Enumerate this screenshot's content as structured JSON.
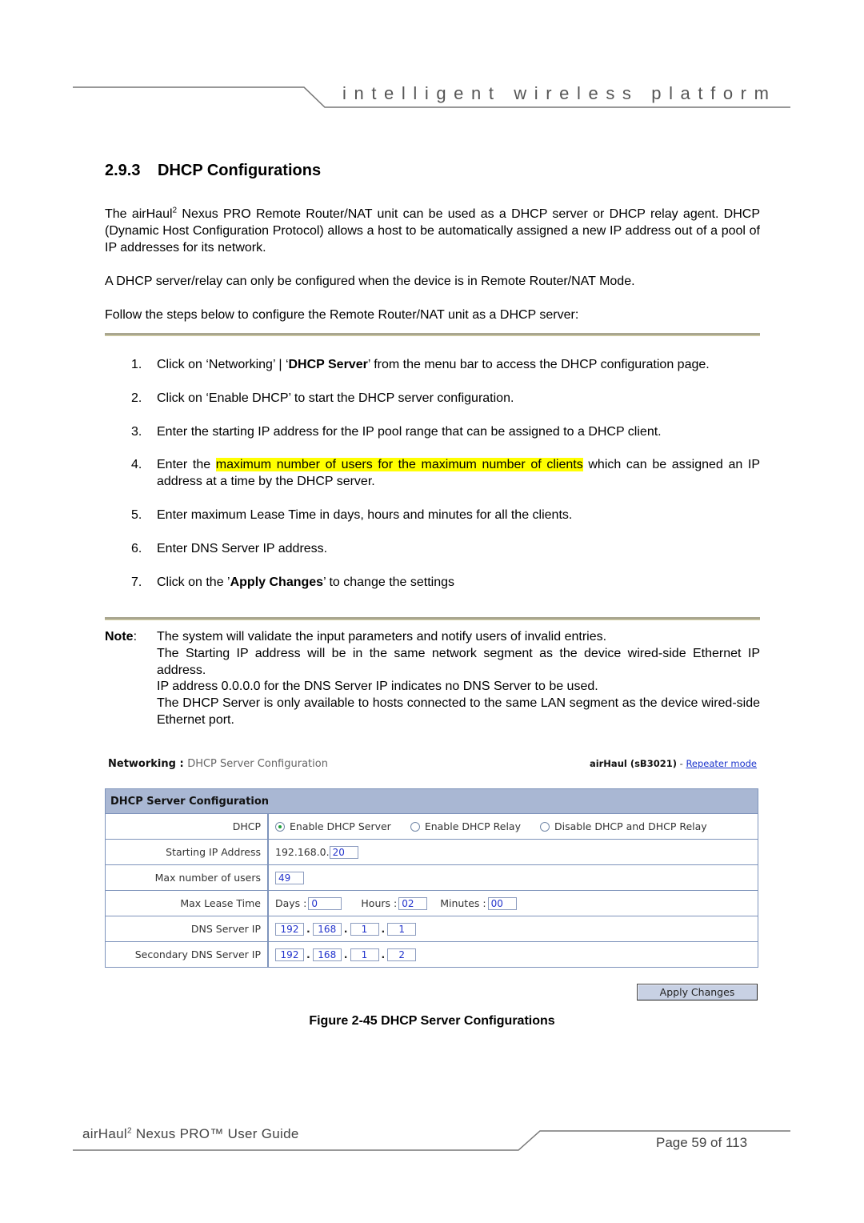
{
  "header": {
    "tagline": "intelligent  wireless  platform"
  },
  "section": {
    "number": "2.9.3",
    "title": "DHCP Configurations"
  },
  "intro": {
    "p1_pre": "The airHaul",
    "p1_sup": "2",
    "p1_post": " Nexus PRO Remote Router/NAT unit can be used as a DHCP server or DHCP relay agent. DHCP (Dynamic Host Configuration Protocol) allows a host to be automatically assigned a new IP address out of a pool of IP addresses for its network.",
    "p2": "A DHCP server/relay can only be configured when the device is in Remote Router/NAT Mode.",
    "p3": "Follow the steps below to configure the Remote Router/NAT unit as a DHCP server:"
  },
  "steps": [
    {
      "num": "1.",
      "pre": "Click on ‘Networking’ | ‘",
      "bold": "DHCP Server",
      "post": "’ from the menu bar to access the DHCP configuration page."
    },
    {
      "num": "2.",
      "text": "Click on ‘Enable DHCP’ to start the DHCP server configuration."
    },
    {
      "num": "3.",
      "text": "Enter the starting IP address for the IP pool range that can be assigned to a DHCP client."
    },
    {
      "num": "4.",
      "pre": "Enter the ",
      "highlight": "maximum number of users for the maximum number of clients",
      "post": " which can be assigned an IP address at a time by the DHCP server."
    },
    {
      "num": "5.",
      "text": "Enter maximum Lease Time in days, hours and minutes for all the clients."
    },
    {
      "num": "6.",
      "text": "Enter DNS Server IP address."
    },
    {
      "num": "7.",
      "pre": "Click on the ’",
      "bold": "Apply Changes",
      "post": "’ to change the settings"
    }
  ],
  "note": {
    "label": "Note",
    "colon": ":",
    "lines": [
      "The system will validate the input parameters and notify users of invalid entries.",
      "The Starting IP address will be in the same network segment as the device wired-side Ethernet IP address.",
      "IP address 0.0.0.0 for the DNS Server IP indicates no DNS Server to be used.",
      "The DHCP Server is only available to hosts connected to the same LAN segment as the device wired-side Ethernet port."
    ]
  },
  "screenshot": {
    "breadcrumb_section": "Networking : ",
    "breadcrumb_page": "DHCP Server Configuration",
    "device_name": "airHaul (sB3021)",
    "device_sep": " - ",
    "mode_link": "Repeater mode",
    "panel_title": "DHCP Server Configuration",
    "rows": {
      "dhcp": {
        "label": "DHCP",
        "options": [
          {
            "label": "Enable DHCP Server",
            "selected": true
          },
          {
            "label": "Enable DHCP Relay",
            "selected": false
          },
          {
            "label": "Disable DHCP and DHCP Relay",
            "selected": false
          }
        ]
      },
      "start_ip": {
        "label": "Starting IP Address",
        "prefix": "192.168.0.",
        "value": "20"
      },
      "max_users": {
        "label": "Max number of users",
        "value": "49"
      },
      "lease": {
        "label": "Max Lease Time",
        "days_label": "Days :",
        "days": "0",
        "hours_label": "Hours :",
        "hours": "02",
        "minutes_label": "Minutes :",
        "minutes": "00"
      },
      "dns": {
        "label": "DNS Server IP",
        "octets": [
          "192",
          "168",
          "1",
          "1"
        ]
      },
      "dns2": {
        "label": "Secondary DNS Server IP",
        "octets": [
          "192",
          "168",
          "1",
          "2"
        ]
      }
    },
    "apply_label": "Apply Changes"
  },
  "figure_caption": "Figure 2-45 DHCP Server Configurations",
  "footer": {
    "doc_pre": "airHaul",
    "doc_sup": "2",
    "doc_post": " Nexus PRO™ User Guide",
    "page": "Page 59 of 113"
  }
}
